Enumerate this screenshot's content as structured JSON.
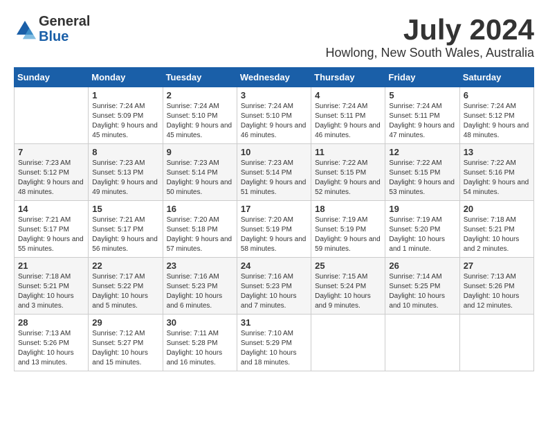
{
  "header": {
    "logo": {
      "general": "General",
      "blue": "Blue"
    },
    "title": "July 2024",
    "subtitle": "Howlong, New South Wales, Australia"
  },
  "weekdays": [
    "Sunday",
    "Monday",
    "Tuesday",
    "Wednesday",
    "Thursday",
    "Friday",
    "Saturday"
  ],
  "weeks": [
    [
      {
        "day": "",
        "sunrise": "",
        "sunset": "",
        "daylight": ""
      },
      {
        "day": "1",
        "sunrise": "Sunrise: 7:24 AM",
        "sunset": "Sunset: 5:09 PM",
        "daylight": "Daylight: 9 hours and 45 minutes."
      },
      {
        "day": "2",
        "sunrise": "Sunrise: 7:24 AM",
        "sunset": "Sunset: 5:10 PM",
        "daylight": "Daylight: 9 hours and 45 minutes."
      },
      {
        "day": "3",
        "sunrise": "Sunrise: 7:24 AM",
        "sunset": "Sunset: 5:10 PM",
        "daylight": "Daylight: 9 hours and 46 minutes."
      },
      {
        "day": "4",
        "sunrise": "Sunrise: 7:24 AM",
        "sunset": "Sunset: 5:11 PM",
        "daylight": "Daylight: 9 hours and 46 minutes."
      },
      {
        "day": "5",
        "sunrise": "Sunrise: 7:24 AM",
        "sunset": "Sunset: 5:11 PM",
        "daylight": "Daylight: 9 hours and 47 minutes."
      },
      {
        "day": "6",
        "sunrise": "Sunrise: 7:24 AM",
        "sunset": "Sunset: 5:12 PM",
        "daylight": "Daylight: 9 hours and 48 minutes."
      }
    ],
    [
      {
        "day": "7",
        "sunrise": "Sunrise: 7:23 AM",
        "sunset": "Sunset: 5:12 PM",
        "daylight": "Daylight: 9 hours and 48 minutes."
      },
      {
        "day": "8",
        "sunrise": "Sunrise: 7:23 AM",
        "sunset": "Sunset: 5:13 PM",
        "daylight": "Daylight: 9 hours and 49 minutes."
      },
      {
        "day": "9",
        "sunrise": "Sunrise: 7:23 AM",
        "sunset": "Sunset: 5:14 PM",
        "daylight": "Daylight: 9 hours and 50 minutes."
      },
      {
        "day": "10",
        "sunrise": "Sunrise: 7:23 AM",
        "sunset": "Sunset: 5:14 PM",
        "daylight": "Daylight: 9 hours and 51 minutes."
      },
      {
        "day": "11",
        "sunrise": "Sunrise: 7:22 AM",
        "sunset": "Sunset: 5:15 PM",
        "daylight": "Daylight: 9 hours and 52 minutes."
      },
      {
        "day": "12",
        "sunrise": "Sunrise: 7:22 AM",
        "sunset": "Sunset: 5:15 PM",
        "daylight": "Daylight: 9 hours and 53 minutes."
      },
      {
        "day": "13",
        "sunrise": "Sunrise: 7:22 AM",
        "sunset": "Sunset: 5:16 PM",
        "daylight": "Daylight: 9 hours and 54 minutes."
      }
    ],
    [
      {
        "day": "14",
        "sunrise": "Sunrise: 7:21 AM",
        "sunset": "Sunset: 5:17 PM",
        "daylight": "Daylight: 9 hours and 55 minutes."
      },
      {
        "day": "15",
        "sunrise": "Sunrise: 7:21 AM",
        "sunset": "Sunset: 5:17 PM",
        "daylight": "Daylight: 9 hours and 56 minutes."
      },
      {
        "day": "16",
        "sunrise": "Sunrise: 7:20 AM",
        "sunset": "Sunset: 5:18 PM",
        "daylight": "Daylight: 9 hours and 57 minutes."
      },
      {
        "day": "17",
        "sunrise": "Sunrise: 7:20 AM",
        "sunset": "Sunset: 5:19 PM",
        "daylight": "Daylight: 9 hours and 58 minutes."
      },
      {
        "day": "18",
        "sunrise": "Sunrise: 7:19 AM",
        "sunset": "Sunset: 5:19 PM",
        "daylight": "Daylight: 9 hours and 59 minutes."
      },
      {
        "day": "19",
        "sunrise": "Sunrise: 7:19 AM",
        "sunset": "Sunset: 5:20 PM",
        "daylight": "Daylight: 10 hours and 1 minute."
      },
      {
        "day": "20",
        "sunrise": "Sunrise: 7:18 AM",
        "sunset": "Sunset: 5:21 PM",
        "daylight": "Daylight: 10 hours and 2 minutes."
      }
    ],
    [
      {
        "day": "21",
        "sunrise": "Sunrise: 7:18 AM",
        "sunset": "Sunset: 5:21 PM",
        "daylight": "Daylight: 10 hours and 3 minutes."
      },
      {
        "day": "22",
        "sunrise": "Sunrise: 7:17 AM",
        "sunset": "Sunset: 5:22 PM",
        "daylight": "Daylight: 10 hours and 5 minutes."
      },
      {
        "day": "23",
        "sunrise": "Sunrise: 7:16 AM",
        "sunset": "Sunset: 5:23 PM",
        "daylight": "Daylight: 10 hours and 6 minutes."
      },
      {
        "day": "24",
        "sunrise": "Sunrise: 7:16 AM",
        "sunset": "Sunset: 5:23 PM",
        "daylight": "Daylight: 10 hours and 7 minutes."
      },
      {
        "day": "25",
        "sunrise": "Sunrise: 7:15 AM",
        "sunset": "Sunset: 5:24 PM",
        "daylight": "Daylight: 10 hours and 9 minutes."
      },
      {
        "day": "26",
        "sunrise": "Sunrise: 7:14 AM",
        "sunset": "Sunset: 5:25 PM",
        "daylight": "Daylight: 10 hours and 10 minutes."
      },
      {
        "day": "27",
        "sunrise": "Sunrise: 7:13 AM",
        "sunset": "Sunset: 5:26 PM",
        "daylight": "Daylight: 10 hours and 12 minutes."
      }
    ],
    [
      {
        "day": "28",
        "sunrise": "Sunrise: 7:13 AM",
        "sunset": "Sunset: 5:26 PM",
        "daylight": "Daylight: 10 hours and 13 minutes."
      },
      {
        "day": "29",
        "sunrise": "Sunrise: 7:12 AM",
        "sunset": "Sunset: 5:27 PM",
        "daylight": "Daylight: 10 hours and 15 minutes."
      },
      {
        "day": "30",
        "sunrise": "Sunrise: 7:11 AM",
        "sunset": "Sunset: 5:28 PM",
        "daylight": "Daylight: 10 hours and 16 minutes."
      },
      {
        "day": "31",
        "sunrise": "Sunrise: 7:10 AM",
        "sunset": "Sunset: 5:29 PM",
        "daylight": "Daylight: 10 hours and 18 minutes."
      },
      {
        "day": "",
        "sunrise": "",
        "sunset": "",
        "daylight": ""
      },
      {
        "day": "",
        "sunrise": "",
        "sunset": "",
        "daylight": ""
      },
      {
        "day": "",
        "sunrise": "",
        "sunset": "",
        "daylight": ""
      }
    ]
  ]
}
